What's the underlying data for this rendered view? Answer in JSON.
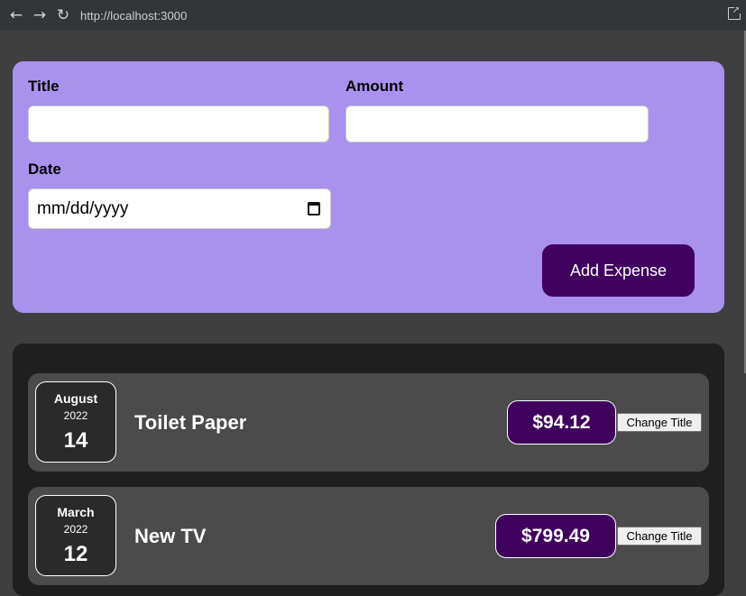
{
  "browser": {
    "url": "http://localhost:3000"
  },
  "form": {
    "title_label": "Title",
    "title_value": "",
    "amount_label": "Amount",
    "amount_value": "",
    "date_label": "Date",
    "date_placeholder": "mm/dd/yyyy",
    "submit_label": "Add Expense"
  },
  "expenses": [
    {
      "month": "August",
      "year": "2022",
      "day": "14",
      "title": "Toilet Paper",
      "amount": "$94.12",
      "change_label": "Change Title"
    },
    {
      "month": "March",
      "year": "2022",
      "day": "12",
      "title": "New TV",
      "amount": "$799.49",
      "change_label": "Change Title"
    }
  ],
  "colors": {
    "form_bg": "#a892ee",
    "accent": "#40005e",
    "list_bg": "#1f1f1f",
    "item_bg": "#4b4b4b",
    "page_bg": "#3f3f3f"
  },
  "icons": [
    "back-arrow-icon",
    "forward-arrow-icon",
    "reload-icon",
    "open-external-icon",
    "calendar-icon"
  ]
}
